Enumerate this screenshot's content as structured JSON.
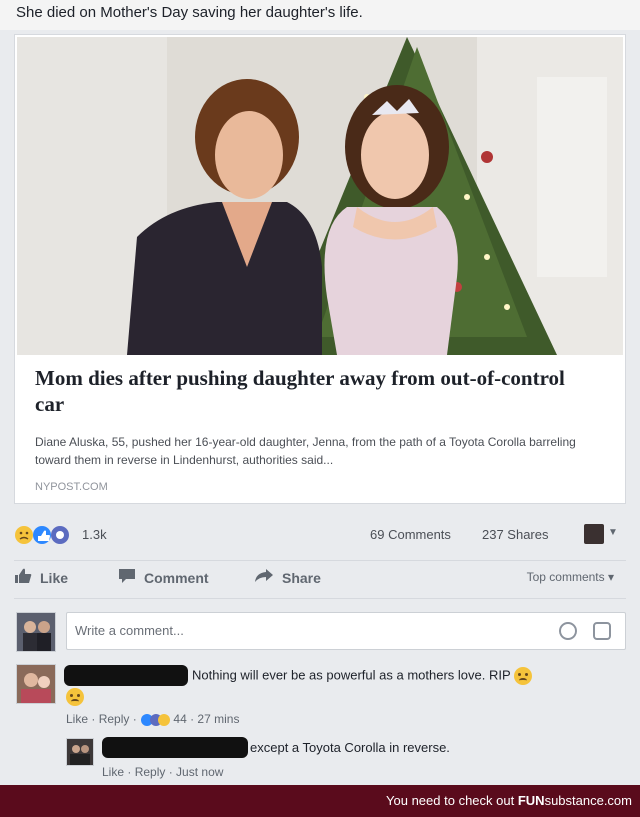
{
  "post": {
    "caption": "She died on Mother's Day saving her daughter's life."
  },
  "link": {
    "title": "Mom dies after pushing daughter away from out-of-control car",
    "description": "Diane Aluska, 55, pushed her 16-year-old daughter, Jenna, from the path of a Toyota Corolla barreling toward them in reverse in Lindenhurst, authorities said...",
    "source": "NYPOST.COM"
  },
  "stats": {
    "reactions_count": "1.3k",
    "comments_count": "69 Comments",
    "shares_count": "237 Shares"
  },
  "actions": {
    "like": "Like",
    "comment": "Comment",
    "share": "Share",
    "sort_label": "Top comments"
  },
  "composer": {
    "placeholder": "Write a comment..."
  },
  "comments": [
    {
      "text": "Nothing will ever be as powerful as a mothers love. RIP",
      "like": "Like",
      "reply": "Reply",
      "reactions": "44",
      "time": "27 mins"
    },
    {
      "text": "except a Toyota Corolla in reverse.",
      "like": "Like",
      "reply": "Reply",
      "time": "Just now"
    }
  ],
  "footer": {
    "prefix": "You need to check out",
    "brand_fun": "FUN",
    "brand_rest": "substance.com"
  },
  "colors": {
    "footer_bg": "#5a0b1c",
    "like_blue": "#2d88ff",
    "sad_yellow": "#f5c33b"
  }
}
